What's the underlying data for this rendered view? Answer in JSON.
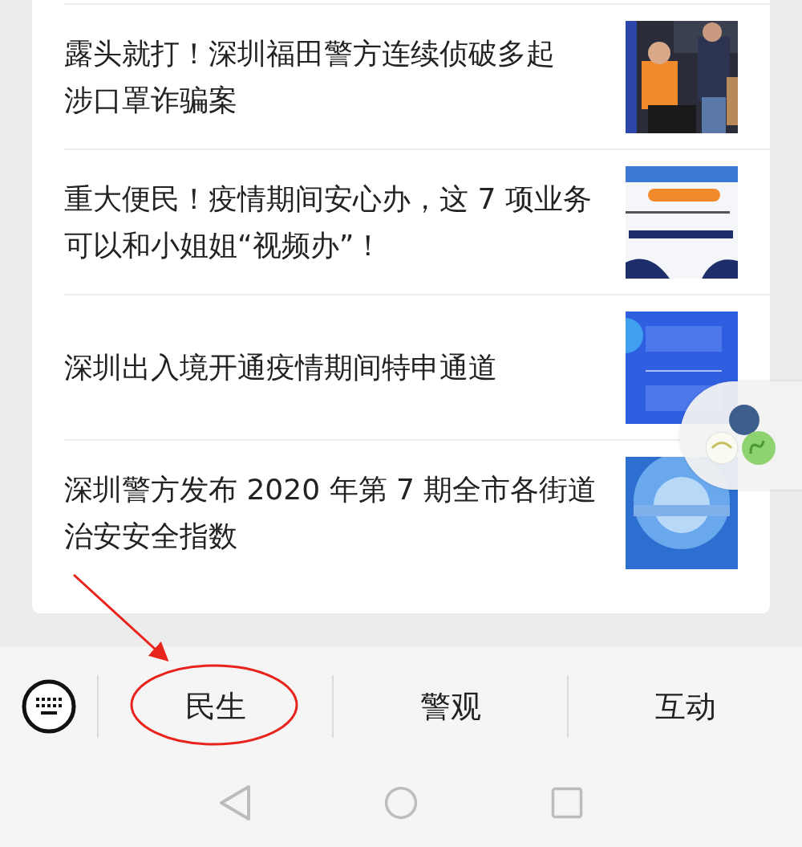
{
  "articles": [
    {
      "title_lines": [
        "露头就打！深圳福田警方连续侦破多起",
        "涉口罩诈骗案"
      ]
    },
    {
      "title_lines": [
        "重大便民！疫情期间安心办，这 7 项业务",
        "可以和小姐姐“视频办”！"
      ]
    },
    {
      "title_lines": [
        "深圳出入境开通疫情期间特申通道"
      ]
    },
    {
      "title_lines": [
        "深圳警方发布 2020 年第 7 期全市各街道",
        "治安安全指数"
      ]
    }
  ],
  "menu": [
    {
      "label": "民生",
      "circled": true
    },
    {
      "label": "警观",
      "circled": false
    },
    {
      "label": "互动",
      "circled": false
    }
  ]
}
